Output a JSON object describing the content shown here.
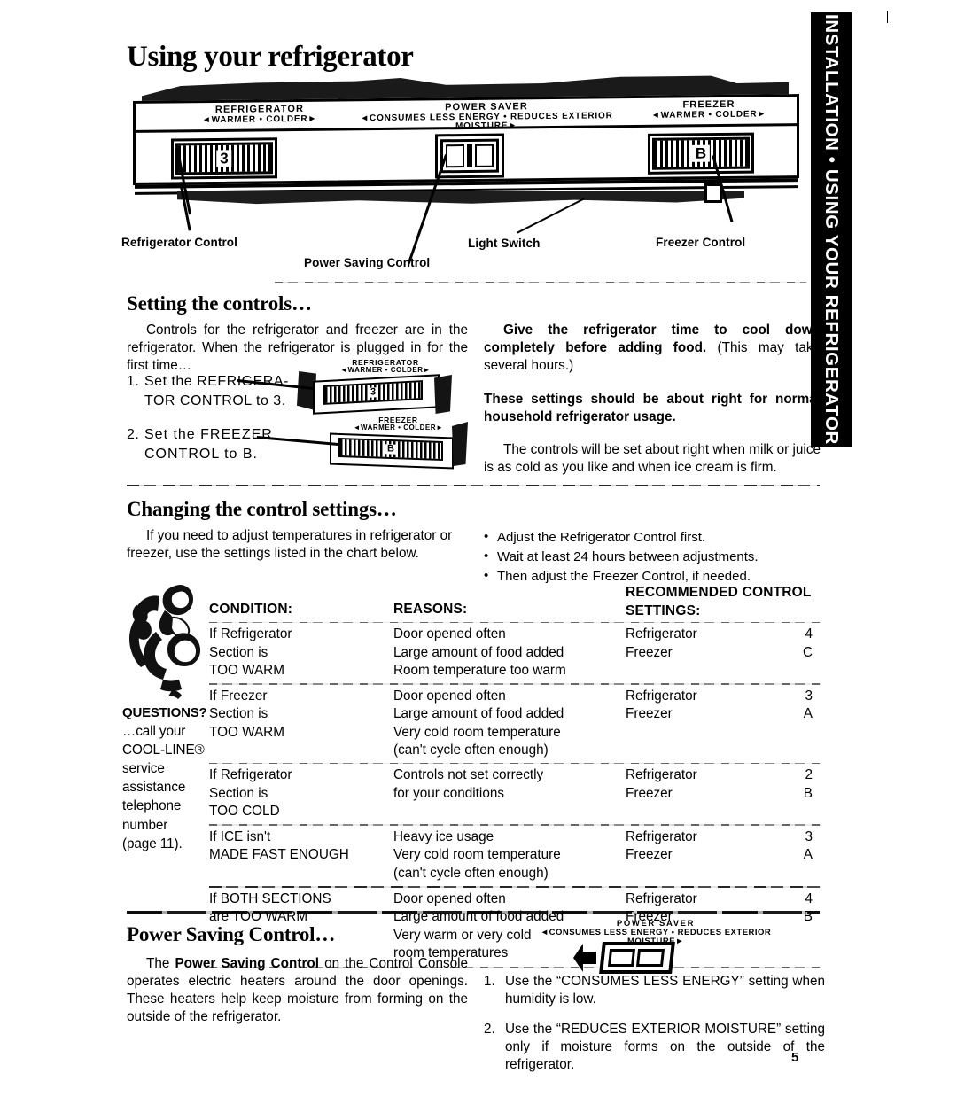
{
  "page": {
    "title": "Using your refrigerator",
    "number": "5",
    "side_tab": "INSTALLATION • USING YOUR REFRIGERATOR"
  },
  "console_illustration": {
    "refrigerator_label": {
      "big": "REFRIGERATOR",
      "small": "◄WARMER  •  COLDER►"
    },
    "power_saver_label": {
      "big": "POWER   SAVER",
      "small": "◄CONSUMES  LESS  ENERGY  •  REDUCES  EXTERIOR  MOISTURE►"
    },
    "freezer_label": {
      "big": "FREEZER",
      "small": "◄WARMER  •  COLDER►"
    },
    "refrigerator_dial_value": "3",
    "freezer_dial_value": "B",
    "callouts": {
      "refrigerator_control": "Refrigerator Control",
      "power_saving_control": "Power Saving Control",
      "light_switch": "Light Switch",
      "freezer_control": "Freezer Control"
    }
  },
  "setting_the_controls": {
    "heading": "Setting the controls…",
    "intro": "Controls for the refrigerator and freezer are in the refrigerator. When the refrigerator is plugged in for the first time…",
    "steps": [
      {
        "num": "1.",
        "text": "Set the REFRIGERA-\nTOR CONTROL to 3."
      },
      {
        "num": "2.",
        "text": "Set the FREEZER\nCONTROL to B."
      }
    ],
    "step1_figure": {
      "big": "REFRIGERATOR",
      "small": "◄WARMER  •  COLDER►",
      "dial_value": "3"
    },
    "step2_figure": {
      "big": "FREEZER",
      "small": "◄WARMER  •  COLDER►",
      "dial_value": "B"
    },
    "right_para1_bold": "Give the refrigerator time to cool down completely before adding food.",
    "right_para1_rest": "(This may take several hours.)",
    "right_para2_bold": "These settings should be about right for normal household refrigerator usage.",
    "right_para3": "The controls will be set about right when milk or juice is as cold as you like and when ice cream is firm."
  },
  "changing_the_control_settings": {
    "heading": "Changing the control settings…",
    "intro": "If you need to adjust temperatures in refrigerator or freezer, use the settings listed in the chart below.",
    "bullets": [
      "Adjust the Refrigerator Control first.",
      "Wait at least 24 hours between adjustments.",
      "Then adjust the Freezer Control, if needed."
    ]
  },
  "questions_sidebar": {
    "title": "QUESTIONS?",
    "lines": [
      "…call your",
      "COOL-LINE®",
      "service",
      "assistance",
      "telephone",
      "number",
      "(page 11)."
    ]
  },
  "chart_data": {
    "type": "table",
    "title": "",
    "columns": [
      "CONDITION:",
      "REASONS:",
      "RECOMMENDED CONTROL SETTINGS:"
    ],
    "header_recommended_line1": "RECOMMENDED CONTROL",
    "header_recommended_line2": "SETTINGS:",
    "rows": [
      {
        "condition": [
          "If Refrigerator",
          "Section is",
          "TOO WARM"
        ],
        "reasons": [
          "Door opened often",
          "Large amount of food added",
          "Room temperature too warm"
        ],
        "settings": [
          {
            "control": "Refrigerator",
            "value": "4"
          },
          {
            "control": "Freezer",
            "value": "C"
          }
        ]
      },
      {
        "condition": [
          "If Freezer",
          "Section is",
          "TOO WARM"
        ],
        "reasons": [
          "Door opened often",
          "Large amount of food added",
          "Very cold room temperature",
          "(can't cycle often enough)"
        ],
        "settings": [
          {
            "control": "Refrigerator",
            "value": "3"
          },
          {
            "control": "Freezer",
            "value": "A"
          }
        ]
      },
      {
        "condition": [
          "If Refrigerator",
          "Section is",
          "TOO COLD"
        ],
        "reasons": [
          "Controls not set correctly",
          "for your conditions"
        ],
        "settings": [
          {
            "control": "Refrigerator",
            "value": "2"
          },
          {
            "control": "Freezer",
            "value": "B"
          }
        ]
      },
      {
        "condition": [
          "If ICE isn't",
          "MADE FAST ENOUGH"
        ],
        "reasons": [
          "Heavy ice usage",
          "Very cold room temperature",
          "(can't cycle often enough)"
        ],
        "settings": [
          {
            "control": "Refrigerator",
            "value": "3"
          },
          {
            "control": "Freezer",
            "value": "A"
          }
        ]
      },
      {
        "condition": [
          "If BOTH SECTIONS",
          "are TOO WARM"
        ],
        "reasons": [
          "Door opened often",
          "Large amount of food added",
          "Very warm or very cold",
          "room temperatures"
        ],
        "settings": [
          {
            "control": "Refrigerator",
            "value": "4"
          },
          {
            "control": "Freezer",
            "value": "B"
          }
        ]
      }
    ]
  },
  "power_saving_control": {
    "heading": "Power Saving Control…",
    "para_part1": "The ",
    "para_bold": "Power Saving Control",
    "para_part2": " on the Control Console operates electric heaters around the door openings. These heaters help keep moisture from forming on the outside of the refrigerator.",
    "figure_label_big": "POWER   SAVER",
    "figure_label_small": "◄CONSUMES  LESS  ENERGY  •  REDUCES  EXTERIOR  MOISTURE►",
    "items": [
      {
        "num": "1.",
        "text": "Use the “CONSUMES LESS ENERGY” setting when humidity is low."
      },
      {
        "num": "2.",
        "text": "Use the “REDUCES EXTERIOR MOISTURE” setting only if moisture forms on the outside of the refrigerator."
      }
    ]
  }
}
